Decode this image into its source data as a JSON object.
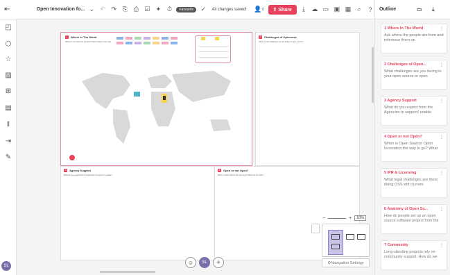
{
  "app": {
    "board_title": "Open Innovation fo...",
    "favorite_badge": "Favourite",
    "saved_status": "All changes saved!",
    "collaborator_count": "0",
    "share_label": "Share"
  },
  "outline": {
    "title": "Outline",
    "items": [
      {
        "number": "1",
        "title": "Where In The World",
        "desc": "Ask where the people are from and reference them on"
      },
      {
        "number": "2",
        "title": "Challenges of Open...",
        "desc": "What challenges are you facing in your open source or open"
      },
      {
        "number": "3",
        "title": "Agency Support",
        "desc": "What do you expect from the Agencies to support/ enable"
      },
      {
        "number": "4",
        "title": "Open or not Open?",
        "desc": "When is Open Source/ Open Innovation the way to go? What"
      },
      {
        "number": "5",
        "title": "IPR & Licensing",
        "desc": "What legal challenges are there doing OSS with current"
      },
      {
        "number": "6",
        "title": "Anatomy of Open So...",
        "desc": "How do people set up an open source software project from the"
      },
      {
        "number": "7",
        "title": "Community",
        "desc": "Long-standing projects rely on community support. How do we"
      }
    ]
  },
  "frames": {
    "f1": {
      "number": "1",
      "title": "Where In The World",
      "text": "Where in the world are you from? Add a sticky to the map."
    },
    "f2": {
      "number": "2",
      "title": "Challenges of Openness",
      "text": "What are the challenges you are facing in open source?"
    },
    "f3": {
      "number": "3",
      "title": "Agency Support",
      "text": "What do you expect from the Agencies to support or enable?"
    },
    "f4": {
      "number": "4",
      "title": "Open or not Open?",
      "text": "When is Open Source the way to go? What are the risks?"
    }
  },
  "zoom": {
    "level": "10%",
    "minus": "−",
    "plus": "+"
  },
  "navigation": {
    "settings_label": "Navigation Settings"
  },
  "user": {
    "initials": "SL"
  },
  "colors": {
    "accent": "#e8415b",
    "avatar": "#7a6fa8"
  }
}
